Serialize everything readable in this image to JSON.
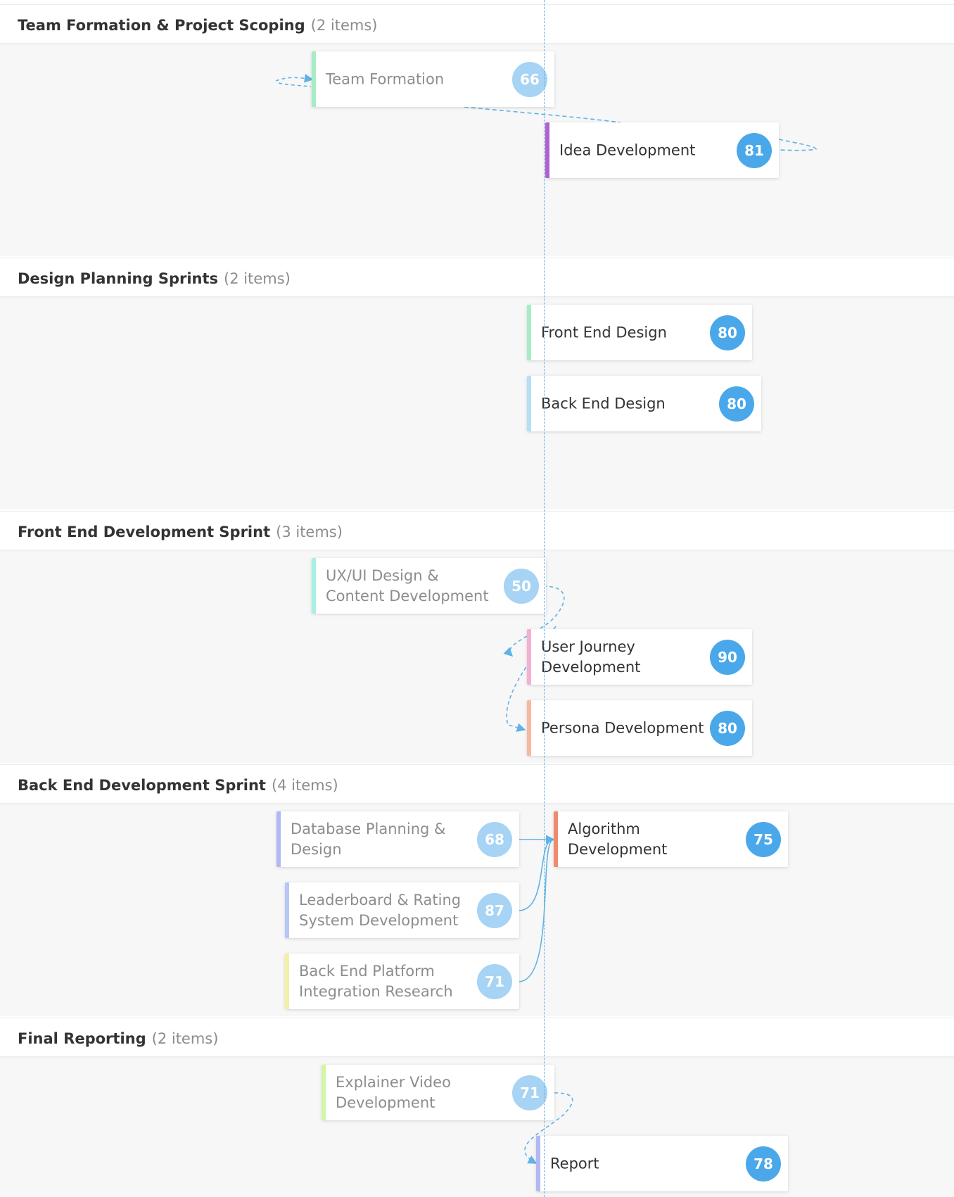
{
  "lanes": [
    {
      "title": "Team Formation & Project Scoping",
      "count": "(2 items)"
    },
    {
      "title": "Design Planning Sprints",
      "count": "(2 items)"
    },
    {
      "title": "Front End Development Sprint",
      "count": "(3 items)"
    },
    {
      "title": "Back End Development Sprint",
      "count": "(4 items)"
    },
    {
      "title": "Final Reporting",
      "count": "(2 items)"
    }
  ],
  "cards": [
    {
      "label": "Team Formation",
      "score": "66",
      "accent": "#a6ecc4",
      "dim": true
    },
    {
      "label": "Idea Development",
      "score": "81",
      "accent": "#b25fd0",
      "dim": false
    },
    {
      "label": "Front End Design",
      "score": "80",
      "accent": "#a6ecc4",
      "dim": false
    },
    {
      "label": "Back End Design",
      "score": "80",
      "accent": "#b6def5",
      "dim": false
    },
    {
      "label": "UX/UI Design & Content Development",
      "score": "50",
      "accent": "#a6f0e4",
      "dim": true
    },
    {
      "label": "User Journey Development",
      "score": "90",
      "accent": "#f4b0d2",
      "dim": false
    },
    {
      "label": "Persona Development",
      "score": "80",
      "accent": "#f7b8a0",
      "dim": false
    },
    {
      "label": "Database Planning & Design",
      "score": "68",
      "accent": "#b1b8f3",
      "dim": true
    },
    {
      "label": "Leaderboard & Rating System Development",
      "score": "87",
      "accent": "#b6c7f5",
      "dim": true
    },
    {
      "label": "Back End Platform Integration Research",
      "score": "71",
      "accent": "#f5f0a0",
      "dim": true
    },
    {
      "label": "Algorithm Development",
      "score": "75",
      "accent": "#f08a6e",
      "dim": false
    },
    {
      "label": "Explainer Video Development",
      "score": "71",
      "accent": "#d4f5a6",
      "dim": true
    },
    {
      "label": "Report",
      "score": "78",
      "accent": "#b1b8f3",
      "dim": false
    }
  ],
  "colors": {
    "accent": "#4aa8ea",
    "badge_dim": "#a7d3f4",
    "connector": "#5fb3e6"
  }
}
